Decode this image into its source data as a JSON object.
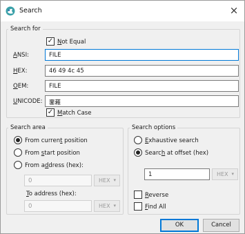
{
  "window": {
    "title": "Search",
    "close_glyph": "×",
    "icon": "app-search-icon"
  },
  "search_for": {
    "legend": "Search for",
    "not_equal": {
      "pre": "",
      "acc": "N",
      "post": "ot Equal",
      "checked": true
    },
    "ansi": {
      "acc": "A",
      "post": "NSI:",
      "value": "FILE"
    },
    "hex": {
      "acc": "H",
      "post": "EX:",
      "value": "46 49 4c 45"
    },
    "oem": {
      "acc": "O",
      "post": "EM:",
      "value": "FILE"
    },
    "unicode": {
      "acc": "U",
      "post": "NICODE:",
      "value": "䥆䕌"
    },
    "match_case": {
      "acc": "M",
      "post": "atch Case",
      "checked": true
    }
  },
  "search_area": {
    "legend": "Search area",
    "from_current": {
      "pre": "From curren",
      "acc": "t",
      "post": " position",
      "selected": true
    },
    "from_start": {
      "pre": "From ",
      "acc": "s",
      "post": "tart position",
      "selected": false
    },
    "from_address": {
      "pre": "From a",
      "acc": "d",
      "post": "dress (hex):",
      "selected": false
    },
    "from_address_value": "0",
    "from_address_base": "HEX",
    "to_address": {
      "acc": "T",
      "post": "o address (hex):"
    },
    "to_address_value": "0",
    "to_address_base": "HEX"
  },
  "search_options": {
    "legend": "Search options",
    "exhaustive": {
      "pre": "",
      "acc": "E",
      "post": "xhaustive search",
      "selected": false
    },
    "at_offset": {
      "pre": "Searc",
      "acc": "h",
      "post": " at offset (hex)",
      "selected": true
    },
    "offset_value": "1",
    "offset_base": "HEX",
    "reverse": {
      "acc": "R",
      "post": "everse",
      "checked": false
    },
    "find_all": {
      "acc": "F",
      "post": "ind All",
      "checked": false
    }
  },
  "buttons": {
    "ok": "OK",
    "cancel": "Cancel"
  },
  "colors": {
    "accent": "#0078d7",
    "dialog_bg": "#f0f0f0",
    "titlebar_bg": "#ffffff"
  }
}
